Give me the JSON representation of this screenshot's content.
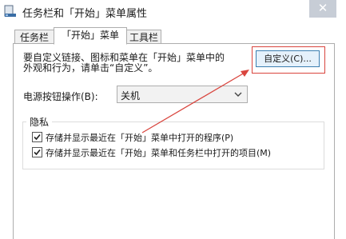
{
  "window": {
    "title": "任务栏和「开始」菜单属性",
    "close_glyph": "✕"
  },
  "tabs": [
    {
      "label": "任务栏",
      "selected": false
    },
    {
      "label": "「开始」菜单",
      "selected": true
    },
    {
      "label": "工具栏",
      "selected": false
    }
  ],
  "start_menu": {
    "description": "要自定义链接、图标和菜单在「开始」菜单中的\n外观和行为，请单击“自定义”。",
    "customize_label": "自定义(C)...",
    "power_button_label": "电源按钮操作(B):",
    "power_button_value": "关机",
    "privacy_group_label": "隐私",
    "store_programs_label": "存储并显示最近在「开始」菜单中打开的程序(P)",
    "store_programs_checked": true,
    "store_items_label": "存储并显示最近在「开始」菜单和任务栏中打开的项目(M)",
    "store_items_checked": true
  },
  "annotation_color": "#d9453e",
  "icons": {
    "app": "taskbar-icon",
    "close": "close-icon",
    "dropdown": "chevron-down-icon",
    "check": "checkmark-icon"
  }
}
